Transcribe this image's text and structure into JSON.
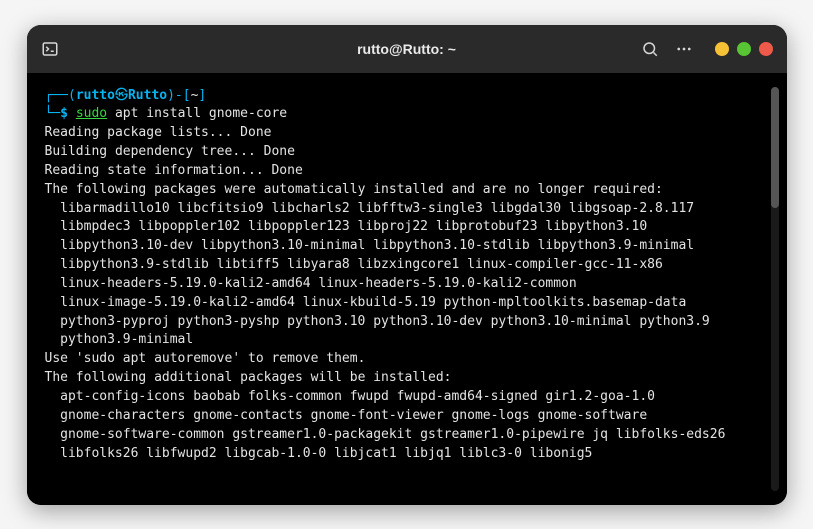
{
  "titlebar": {
    "title": "rutto@Rutto: ~"
  },
  "prompt": {
    "open": "┌──(",
    "user": "rutto",
    "sep_glyph": "㉿",
    "host": "Rutto",
    "close": ")-[",
    "path": "~",
    "end": "]",
    "line2_corner": "└─",
    "dollar": "$",
    "sudo": "sudo",
    "rest": " apt install gnome-core"
  },
  "out": {
    "l1": "Reading package lists... Done",
    "l2": "Building dependency tree... Done",
    "l3": "Reading state information... Done",
    "l4": "The following packages were automatically installed and are no longer required:",
    "p1": "libarmadillo10 libcfitsio9 libcharls2 libfftw3-single3 libgdal30 libgsoap-2.8.117",
    "p2": "libmpdec3 libpoppler102 libpoppler123 libproj22 libprotobuf23 libpython3.10",
    "p3": "libpython3.10-dev libpython3.10-minimal libpython3.10-stdlib libpython3.9-minimal",
    "p4": "libpython3.9-stdlib libtiff5 libyara8 libzxingcore1 linux-compiler-gcc-11-x86",
    "p5": "linux-headers-5.19.0-kali2-amd64 linux-headers-5.19.0-kali2-common",
    "p6": "linux-image-5.19.0-kali2-amd64 linux-kbuild-5.19 python-mpltoolkits.basemap-data",
    "p7": "python3-pyproj python3-pyshp python3.10 python3.10-dev python3.10-minimal python3.9",
    "p8": "python3.9-minimal",
    "l5": "Use 'sudo apt autoremove' to remove them.",
    "l6": "The following additional packages will be installed:",
    "q1": "apt-config-icons baobab folks-common fwupd fwupd-amd64-signed gir1.2-goa-1.0",
    "q2": "gnome-characters gnome-contacts gnome-font-viewer gnome-logs gnome-software",
    "q3": "gnome-software-common gstreamer1.0-packagekit gstreamer1.0-pipewire jq libfolks-eds26",
    "q4": "libfolks26 libfwupd2 libgcab-1.0-0 libjcat1 libjq1 liblc3-0 libonig5"
  }
}
